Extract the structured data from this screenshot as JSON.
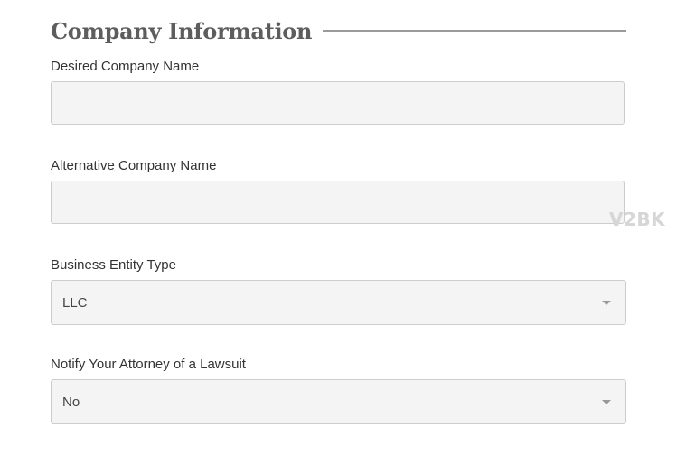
{
  "section": {
    "title": "Company Information"
  },
  "fields": {
    "desired_name": {
      "label": "Desired Company Name",
      "value": ""
    },
    "alternative_name": {
      "label": "Alternative Company Name",
      "value": ""
    },
    "entity_type": {
      "label": "Business Entity Type",
      "selected": "LLC"
    },
    "notify_attorney": {
      "label": "Notify Your Attorney of a Lawsuit",
      "selected": "No"
    }
  },
  "watermark": "V2BK",
  "colors": {
    "input_background": "#f4f4f4",
    "input_border": "#cccccc",
    "title_text": "#5d5d5d",
    "label_text": "#333333"
  },
  "icons": {
    "select_caret": "chevron-down-icon"
  }
}
